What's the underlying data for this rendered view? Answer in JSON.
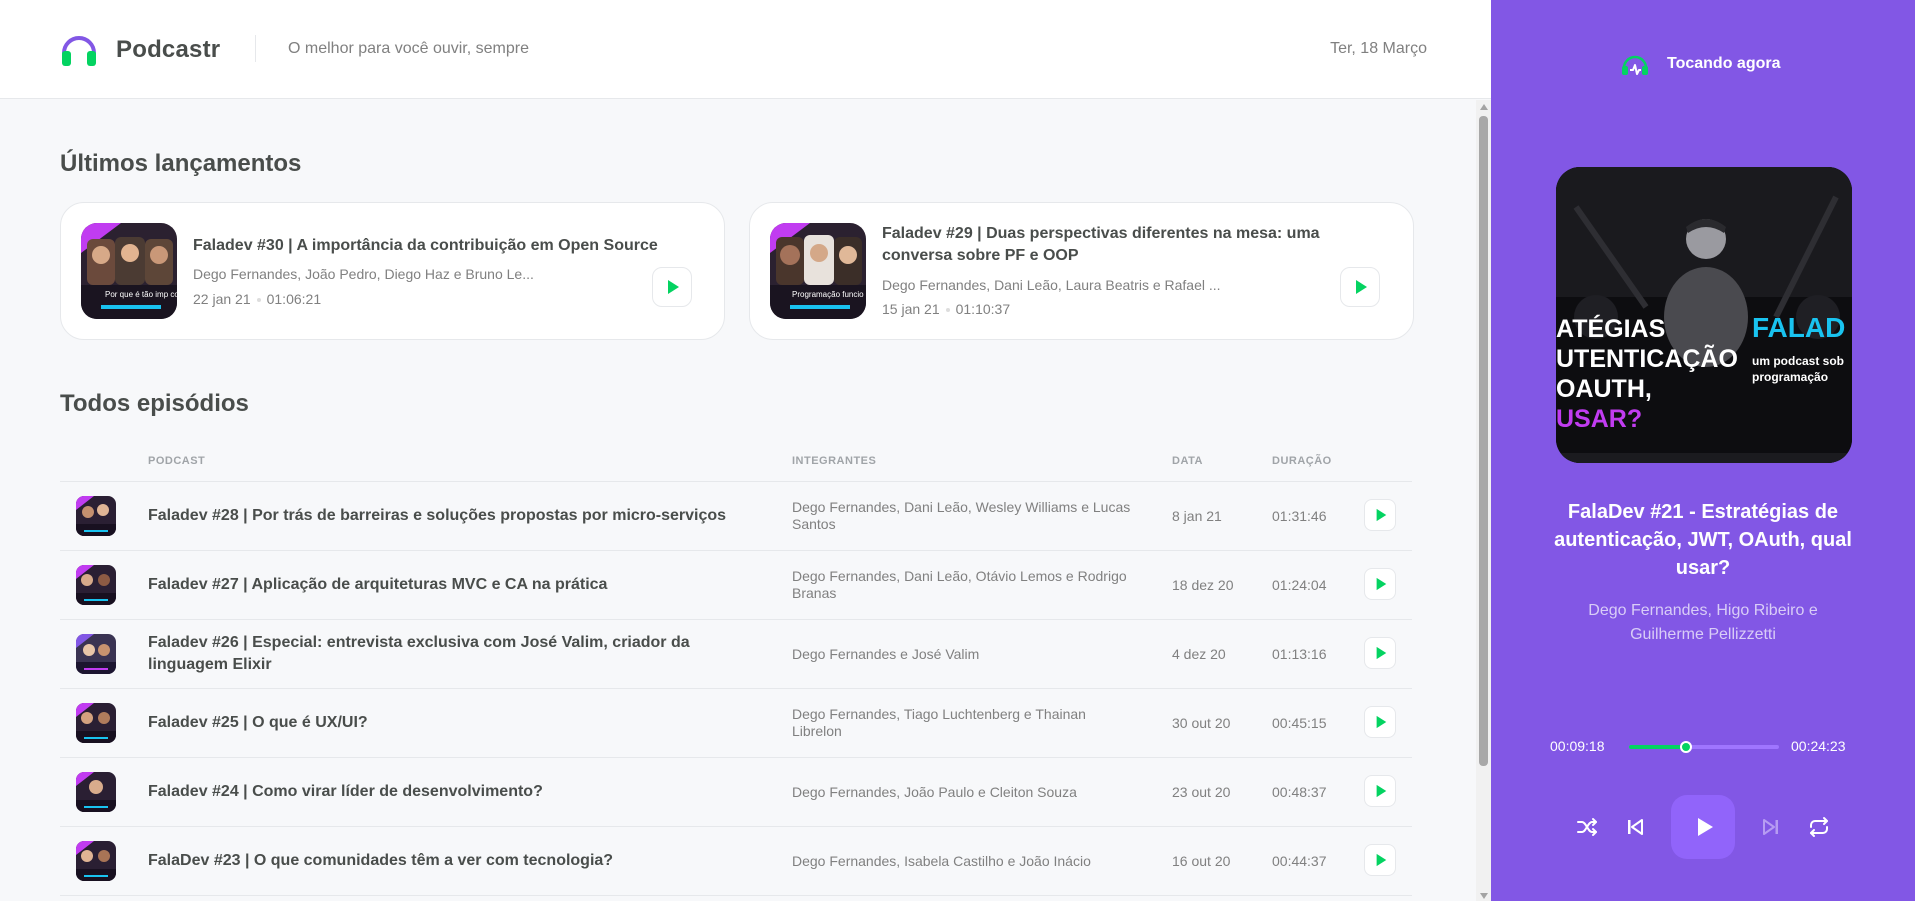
{
  "header": {
    "brand": "Podcastr",
    "tagline": "O melhor para você ouvir, sempre",
    "date": "Ter, 18 Março"
  },
  "latest": {
    "title": "Últimos lançamentos",
    "episodes": [
      {
        "title": "Faladev #30 | A importância da contribuição em Open Source",
        "members": "Dego Fernandes, João Pedro, Diego Haz e Bruno Le...",
        "date": "22 jan 21",
        "duration": "01:06:21",
        "thumb_caption": "Por que é tão imp contribuir em Open S"
      },
      {
        "title": "Faladev #29 | Duas perspectivas diferentes na mesa: uma conversa sobre PF e OOP",
        "members": "Dego Fernandes, Dani Leão, Laura Beatris e Rafael ...",
        "date": "15 jan 21",
        "duration": "01:10:37",
        "thumb_caption": "Programação funcio devs orientados a o"
      }
    ]
  },
  "all": {
    "title": "Todos episódios",
    "columns": [
      "Podcast",
      "Integrantes",
      "Data",
      "Duração"
    ],
    "episodes": [
      {
        "title": "Faladev #28 | Por trás de barreiras e soluções propostas por micro-serviços",
        "members": "Dego Fernandes, Dani Leão, Wesley Williams e Lucas Santos",
        "date": "8 jan 21",
        "duration": "01:31:46"
      },
      {
        "title": "Faladev #27 | Aplicação de arquiteturas MVC e CA na prática",
        "members": "Dego Fernandes, Dani Leão, Otávio Lemos e Rodrigo Branas",
        "date": "18 dez 20",
        "duration": "01:24:04"
      },
      {
        "title": "Faladev #26 | Especial: entrevista exclusiva com José Valim, criador da linguagem Elixir",
        "members": "Dego Fernandes e José Valim",
        "date": "4 dez 20",
        "duration": "01:13:16"
      },
      {
        "title": "Faladev #25 | O que é UX/UI?",
        "members": "Dego Fernandes, Tiago Luchtenberg e Thainan Librelon",
        "date": "30 out 20",
        "duration": "00:45:15"
      },
      {
        "title": "Faladev #24 | Como virar líder de desenvolvimento?",
        "members": "Dego Fernandes, João Paulo e Cleiton Souza",
        "date": "23 out 20",
        "duration": "00:48:37"
      },
      {
        "title": "FalaDev #23 | O que comunidades têm a ver com tecnologia?",
        "members": "Dego Fernandes, Isabela Castilho e João Inácio",
        "date": "16 out 20",
        "duration": "00:44:37"
      }
    ]
  },
  "player": {
    "label": "Tocando agora",
    "title": "FalaDev #21 - Estratégias de autenticação, JWT, OAuth, qual usar?",
    "members": "Dego Fernandes, Higo Ribeiro e Guilherme Pellizzetti",
    "current_time": "00:09:18",
    "total_time": "00:24:23",
    "progress_fraction": 0.38,
    "cover": {
      "left_text_lines": [
        "ATÉGIAS",
        "UTENTICAÇÃO",
        "OAUTH,",
        "USAR?"
      ],
      "right_brand": "FALAD",
      "right_sub_lines": [
        "um podcast sob",
        "programação"
      ]
    }
  },
  "colors": {
    "accent_purple": "#8257e5",
    "accent_green": "#04d361",
    "text_dark": "#494d4b",
    "text_muted": "#808080"
  },
  "icons": {
    "logo": "headphones-icon",
    "player_header": "playing-now-icon",
    "play": "play-icon",
    "shuffle": "shuffle-icon",
    "previous": "play-previous-icon",
    "next": "play-next-icon",
    "repeat": "repeat-icon"
  }
}
